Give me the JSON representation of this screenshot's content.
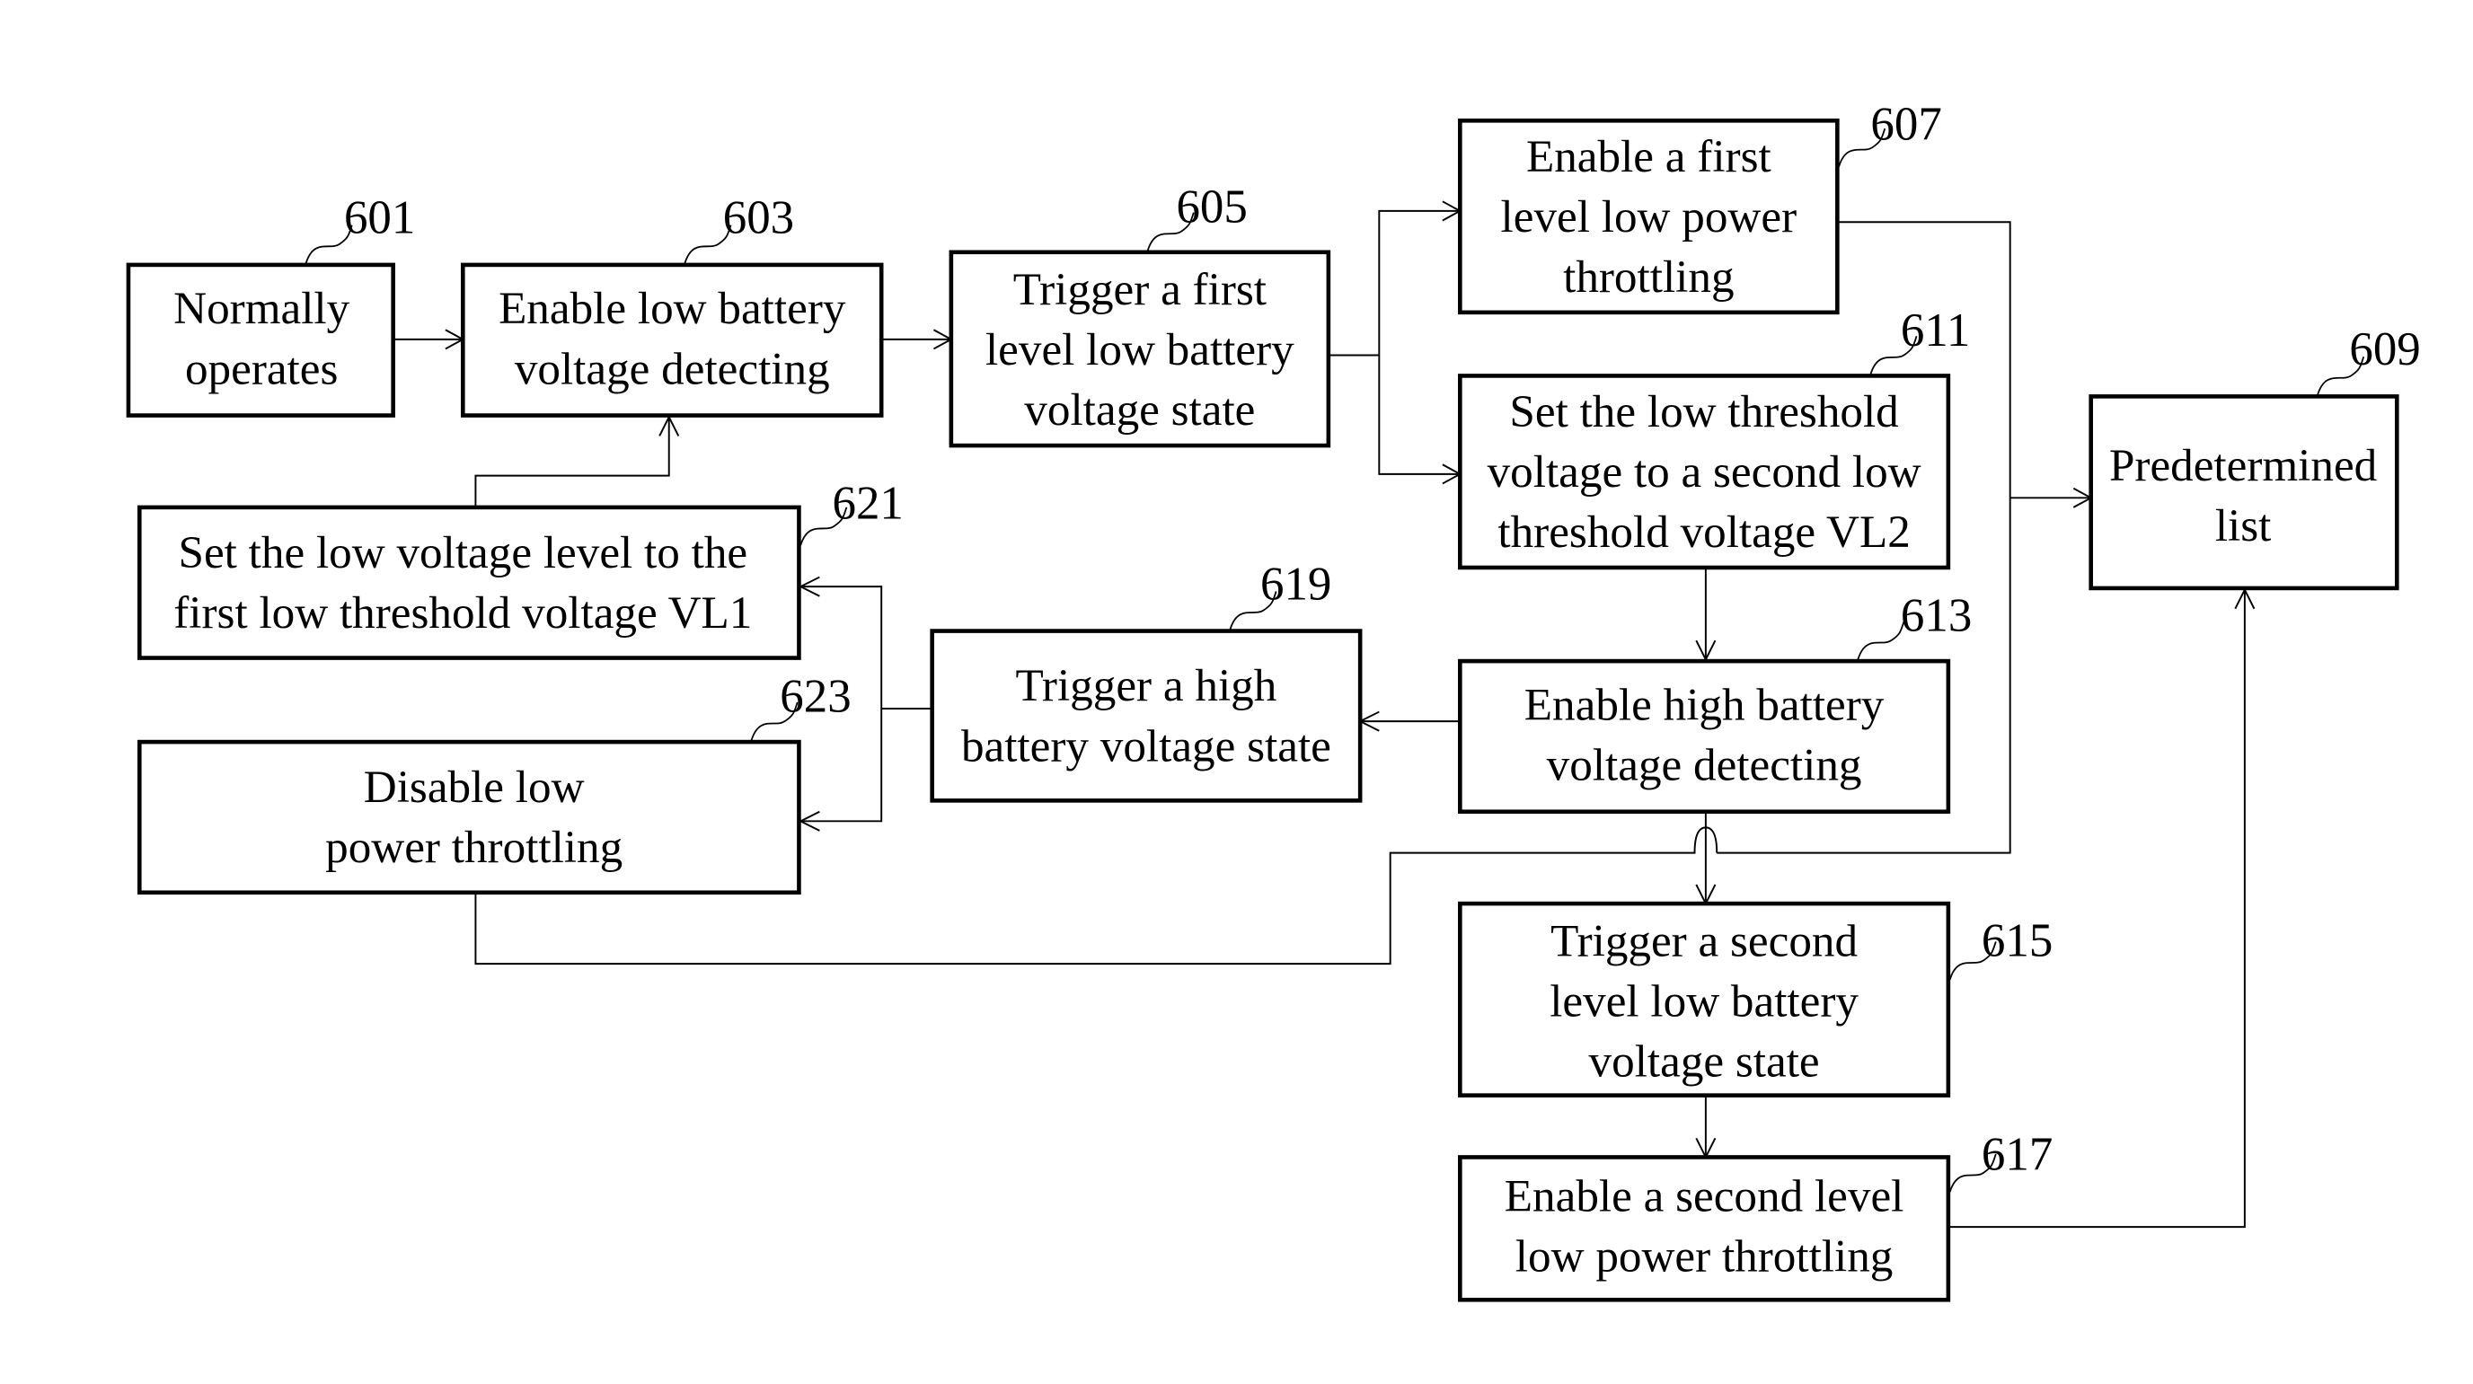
{
  "diagram": {
    "type": "flowchart",
    "nodes": [
      {
        "id": "601",
        "lines": [
          "Normally",
          "operates"
        ]
      },
      {
        "id": "603",
        "lines": [
          "Enable low battery",
          "voltage detecting"
        ]
      },
      {
        "id": "605",
        "lines": [
          "Trigger a first",
          "level low battery",
          "voltage state"
        ]
      },
      {
        "id": "607",
        "lines": [
          "Enable a first",
          "level low power",
          "throttling"
        ]
      },
      {
        "id": "609",
        "lines": [
          "Predetermined",
          "list"
        ]
      },
      {
        "id": "611",
        "lines": [
          "Set the low threshold",
          "voltage to a second low",
          "threshold voltage VL2"
        ]
      },
      {
        "id": "613",
        "lines": [
          "Enable high battery",
          "voltage detecting"
        ]
      },
      {
        "id": "615",
        "lines": [
          "Trigger a second",
          "level low battery",
          "voltage state"
        ]
      },
      {
        "id": "617",
        "lines": [
          "Enable a second level",
          "low power throttling"
        ]
      },
      {
        "id": "619",
        "lines": [
          "Trigger a high",
          "battery voltage state"
        ]
      },
      {
        "id": "621",
        "lines": [
          "Set the low voltage level to the",
          "first low threshold voltage VL1"
        ]
      },
      {
        "id": "623",
        "lines": [
          "Disable low",
          "power throttling"
        ]
      }
    ],
    "edges": [
      [
        "601",
        "603"
      ],
      [
        "603",
        "605"
      ],
      [
        "605",
        "607"
      ],
      [
        "605",
        "611"
      ],
      [
        "607",
        "609"
      ],
      [
        "611",
        "613"
      ],
      [
        "613",
        "619"
      ],
      [
        "613",
        "615"
      ],
      [
        "615",
        "617"
      ],
      [
        "617",
        "609"
      ],
      [
        "619",
        "621"
      ],
      [
        "619",
        "623"
      ],
      [
        "621",
        "603"
      ],
      [
        "623",
        "615"
      ]
    ]
  }
}
